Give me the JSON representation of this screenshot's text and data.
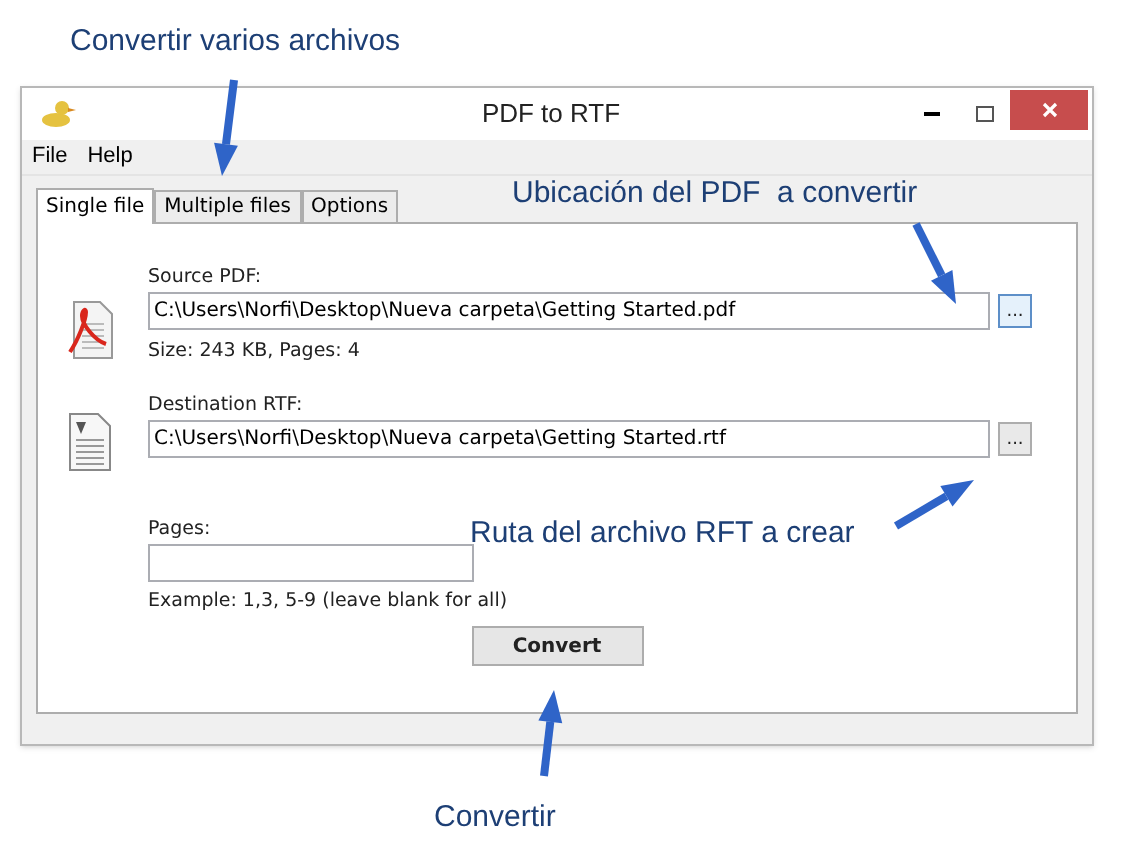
{
  "window": {
    "title": "PDF to RTF"
  },
  "menu": [
    "File",
    "Help"
  ],
  "tabs": [
    {
      "label": "Single file",
      "selected": true
    },
    {
      "label": "Multiple files",
      "selected": false
    },
    {
      "label": "Options",
      "selected": false
    }
  ],
  "source": {
    "label": "Source PDF:",
    "value": "C:\\Users\\Norfi\\Desktop\\Nueva carpeta\\Getting Started.pdf",
    "browse": "...",
    "info": "Size: 243 KB, Pages: 4"
  },
  "destination": {
    "label": "Destination RTF:",
    "value": "C:\\Users\\Norfi\\Desktop\\Nueva carpeta\\Getting Started.rtf",
    "browse": "..."
  },
  "pages": {
    "label": "Pages:",
    "hint": "Example: 1,3, 5-9 (leave blank for all)"
  },
  "convert_button": "Convert",
  "annotations": [
    "Convertir varios archivos",
    "Ubicación del PDF  a convertir",
    "Ruta del archivo RFT a crear",
    "Convertir"
  ]
}
